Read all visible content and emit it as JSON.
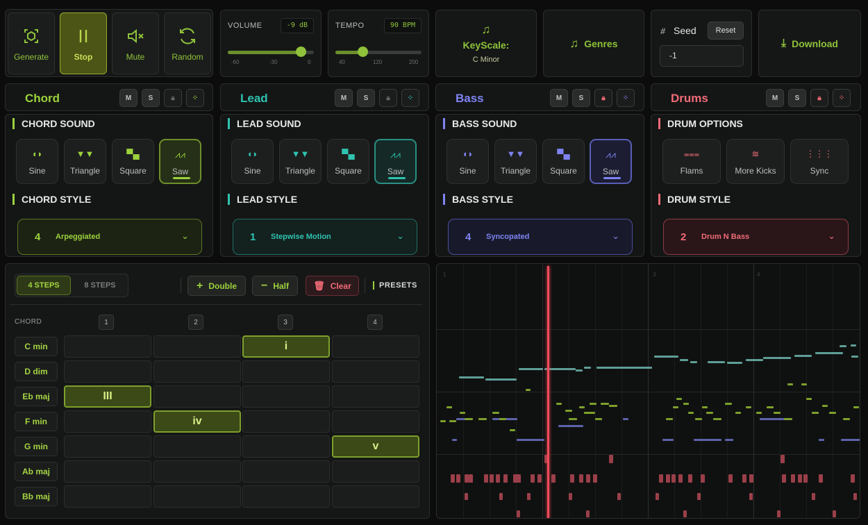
{
  "transport": {
    "buttons": [
      {
        "label": "Generate",
        "icon": "generate-icon"
      },
      {
        "label": "Stop",
        "icon": "pause-icon"
      },
      {
        "label": "Mute",
        "icon": "mute-icon"
      },
      {
        "label": "Random",
        "icon": "random-icon"
      }
    ],
    "volume": {
      "label": "VOLUME",
      "value": "-9 dB",
      "ticks": [
        "-60",
        "-30",
        "0"
      ],
      "level": -9,
      "min": -60,
      "max": 0
    },
    "tempo": {
      "label": "TEMPO",
      "value": "90 BPM",
      "ticks": [
        "40",
        "120",
        "200"
      ],
      "level": 90,
      "min": 40,
      "max": 200
    },
    "keyscale": {
      "label": "KeyScale:",
      "value": "C Minor"
    },
    "genres_label": "Genres",
    "seed": {
      "label": "Seed",
      "reset_label": "Reset",
      "value": "-1"
    },
    "download_label": "Download"
  },
  "tracks": {
    "chord": {
      "name": "Chord",
      "color": "#9bd23c",
      "sound_title": "CHORD SOUND",
      "style_title": "CHORD STYLE",
      "selected_wave": "Saw",
      "style_num": "4",
      "style_name": "Arpeggiated",
      "m": "M",
      "s": "S"
    },
    "lead": {
      "name": "Lead",
      "color": "#2fc3b0",
      "sound_title": "LEAD SOUND",
      "style_title": "LEAD STYLE",
      "selected_wave": "Saw",
      "style_num": "1",
      "style_name": "Stepwise Motion",
      "m": "M",
      "s": "S"
    },
    "bass": {
      "name": "Bass",
      "color": "#7f83f2",
      "sound_title": "BASS SOUND",
      "style_title": "BASS STYLE",
      "selected_wave": "Saw",
      "style_num": "4",
      "style_name": "Syncopated",
      "m": "M",
      "s": "S"
    },
    "drums": {
      "name": "Drums",
      "color": "#f06b77",
      "sound_title": "DRUM OPTIONS",
      "style_title": "DRUM STYLE",
      "style_num": "2",
      "style_name": "Drum N Bass",
      "m": "M",
      "s": "S"
    }
  },
  "waves": [
    "Sine",
    "Triangle",
    "Square",
    "Saw"
  ],
  "drum_options": [
    "Flams",
    "More Kicks",
    "Sync"
  ],
  "sequencer": {
    "step_tabs": [
      "4 STEPS",
      "8 STEPS"
    ],
    "active_tab": "4 STEPS",
    "double_label": "Double",
    "half_label": "Half",
    "clear_label": "Clear",
    "presets_label": "PRESETS",
    "chord_header": "CHORD",
    "columns": [
      "1",
      "2",
      "3",
      "4"
    ],
    "rows": [
      "C min",
      "D dim",
      "Eb maj",
      "F min",
      "G min",
      "Ab maj",
      "Bb maj"
    ],
    "cells": [
      {
        "row": 0,
        "col": 2,
        "label": "i"
      },
      {
        "row": 2,
        "col": 0,
        "label": "III"
      },
      {
        "row": 3,
        "col": 1,
        "label": "iv"
      },
      {
        "row": 4,
        "col": 3,
        "label": "v"
      }
    ]
  },
  "piano_roll": {
    "bar_numbers": [
      "1",
      "3",
      "4"
    ]
  }
}
